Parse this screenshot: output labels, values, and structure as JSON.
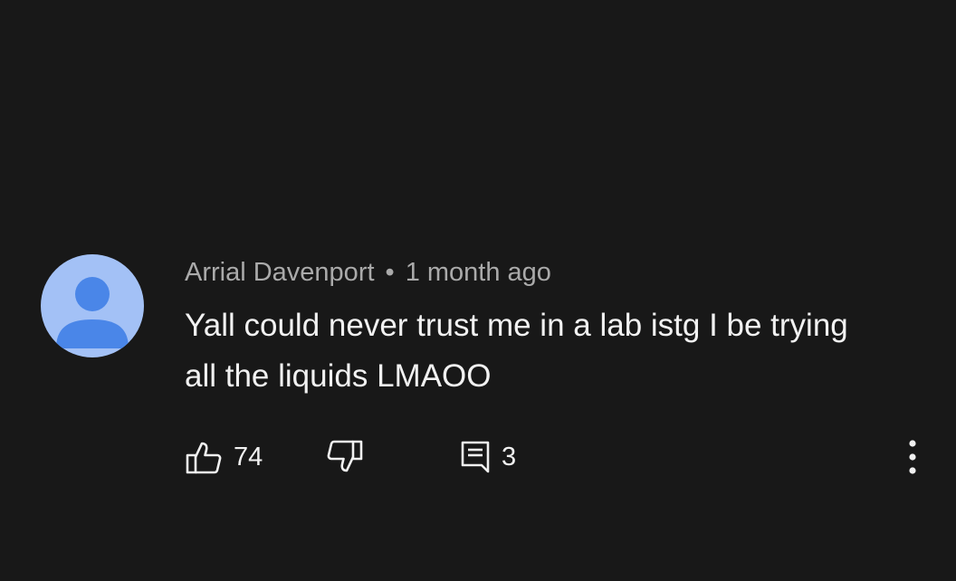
{
  "comment": {
    "author": "Arrial Davenport",
    "separator": "•",
    "time": "1 month ago",
    "text": "Yall could never trust me in a lab istg I be trying all the liquids LMAOO"
  },
  "actions": {
    "like_count": "74",
    "reply_count": "3"
  },
  "icons": {
    "like": "thumbs-up-icon",
    "dislike": "thumbs-down-icon",
    "reply": "reply-comment-icon",
    "more": "more-vertical-icon",
    "avatar": "default-avatar-icon"
  },
  "colors": {
    "background": "#181818",
    "avatar_bg": "#a3c1f6",
    "avatar_fg": "#4a86e8",
    "text_primary": "#f1f1f1",
    "text_secondary": "#aaaaaa"
  }
}
